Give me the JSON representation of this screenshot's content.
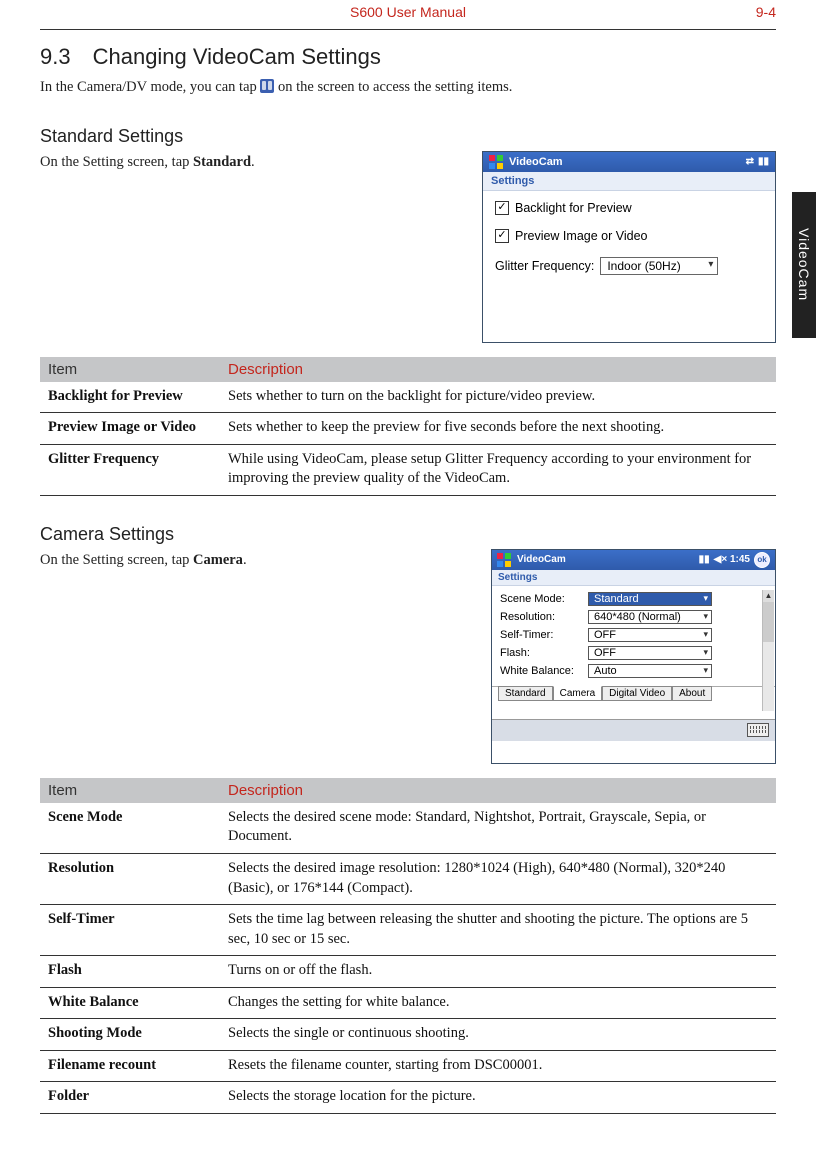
{
  "header": {
    "center": "S600 User Manual",
    "right": "9-4"
  },
  "side_tab": "VideoCam",
  "section": {
    "number": "9.3",
    "title": "Changing VideoCam Settings",
    "intro_before": "In the Camera/DV mode, you can tap ",
    "intro_after": " on the screen to access the setting items."
  },
  "standard": {
    "heading": "Standard Settings",
    "lead_before": "On the Setting screen, tap ",
    "lead_bold": "Standard",
    "lead_after": ".",
    "screenshot": {
      "title": "VideoCam",
      "subtitle": "Settings",
      "check1": "Backlight for Preview",
      "check2": "Preview Image or Video",
      "freq_label": "Glitter Frequency:",
      "freq_value": "Indoor (50Hz)"
    },
    "table": {
      "head_item": "Item",
      "head_desc": "Description",
      "rows": [
        {
          "item": "Backlight for Preview",
          "desc": "Sets whether to turn on the backlight for picture/video preview."
        },
        {
          "item": "Preview Image or Video",
          "desc": "Sets whether to keep the preview for five seconds before the next shooting."
        },
        {
          "item": "Glitter Frequency",
          "desc": "While using VideoCam, please setup Glitter Frequency according to your environment for improving the preview quality of the VideoCam."
        }
      ]
    }
  },
  "camera": {
    "heading": "Camera Settings",
    "lead_before": "On the Setting screen, tap ",
    "lead_bold": "Camera",
    "lead_after": ".",
    "screenshot": {
      "title": "VideoCam",
      "status": "◀× 1:45",
      "ok": "ok",
      "subtitle": "Settings",
      "fields": [
        {
          "label": "Scene Mode:",
          "value": "Standard",
          "hi": true
        },
        {
          "label": "Resolution:",
          "value": "640*480 (Normal)",
          "hi": false
        },
        {
          "label": "Self-Timer:",
          "value": "OFF",
          "hi": false
        },
        {
          "label": "Flash:",
          "value": "OFF",
          "hi": false
        },
        {
          "label": "White Balance:",
          "value": "Auto",
          "hi": false
        }
      ],
      "tabs": [
        "Standard",
        "Camera",
        "Digital Video",
        "About"
      ],
      "active_tab": 1
    },
    "table": {
      "head_item": "Item",
      "head_desc": "Description",
      "rows": [
        {
          "item": "Scene Mode",
          "desc": "Selects the desired scene mode: Standard, Nightshot, Portrait, Grayscale, Sepia, or Document."
        },
        {
          "item": "Resolution",
          "desc": "Selects the desired image resolution: 1280*1024 (High), 640*480 (Normal), 320*240 (Basic), or 176*144 (Compact)."
        },
        {
          "item": "Self-Timer",
          "desc": "Sets the time lag between releasing the shutter and shooting the picture. The options are 5 sec, 10 sec or 15 sec."
        },
        {
          "item": "Flash",
          "desc": "Turns on or off the flash."
        },
        {
          "item": "White Balance",
          "desc": "Changes the setting for white balance."
        },
        {
          "item": "Shooting Mode",
          "desc": "Selects the single or continuous shooting."
        },
        {
          "item": "Filename recount",
          "desc": "Resets the filename counter, starting from DSC00001."
        },
        {
          "item": "Folder",
          "desc": "Selects the storage location for the picture."
        }
      ]
    }
  }
}
